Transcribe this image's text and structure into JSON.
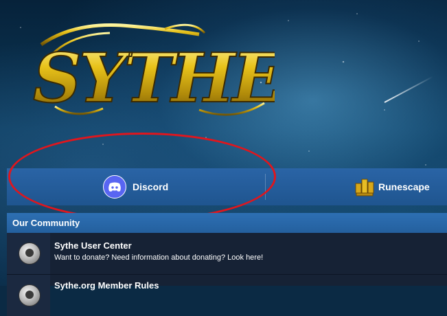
{
  "brand": {
    "logo_text": "SYTHE",
    "logo_color": "#e8c21a"
  },
  "nav": {
    "items": [
      {
        "label": "Discord",
        "icon": "discord-icon"
      },
      {
        "label": "Runescape",
        "icon": "runescape-icon"
      }
    ]
  },
  "community": {
    "header": "Our Community",
    "forums": [
      {
        "title": "Sythe User Center",
        "description": "Want to donate? Need information about donating? Look here!",
        "icon": "forum-icon"
      },
      {
        "title": "Sythe.org Member Rules",
        "description": "",
        "icon": "forum-icon"
      }
    ]
  },
  "colors": {
    "nav_bg": "#2a64a6",
    "header_bg": "#2d6fb3",
    "list_bg": "#162235",
    "highlight": "#e0161d",
    "discord": "#5865f2"
  }
}
